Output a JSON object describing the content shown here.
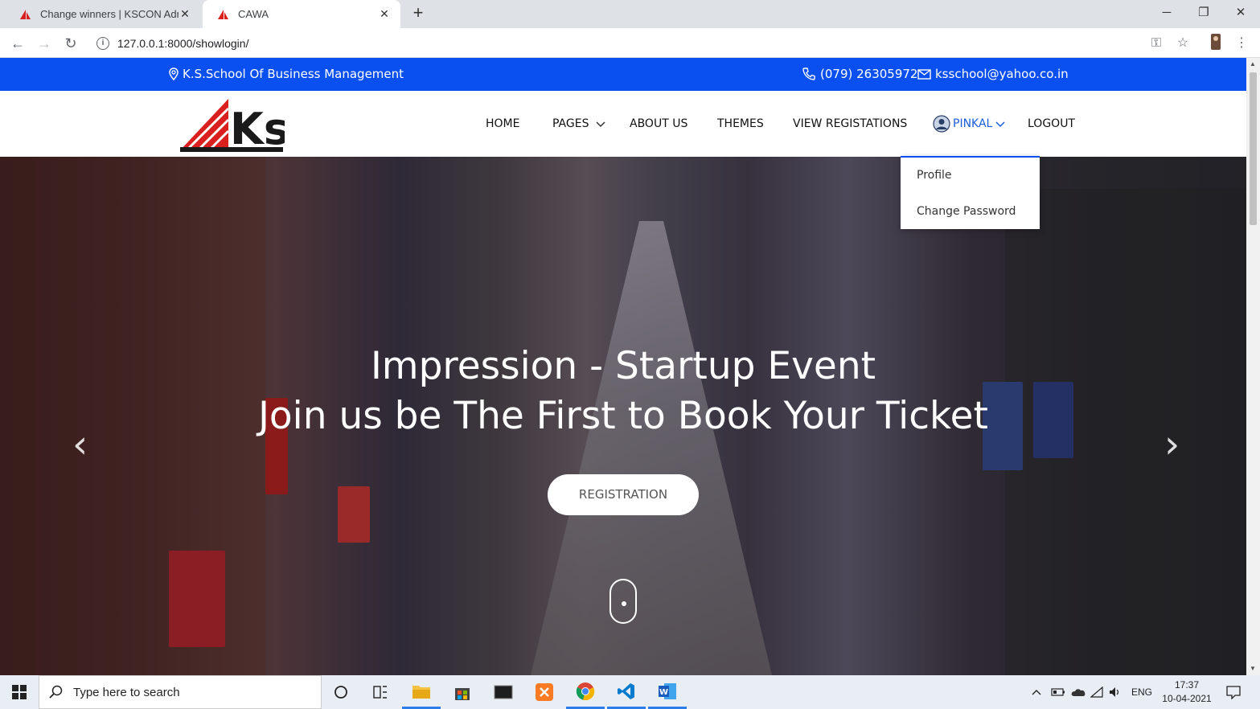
{
  "browser": {
    "tabs": [
      {
        "title": "Change winners | KSCON Admin",
        "active": false
      },
      {
        "title": "CAWA",
        "active": true
      }
    ],
    "url": "127.0.0.1:8000/showlogin/"
  },
  "topbar": {
    "location": "K.S.School Of Business Management",
    "phone": "(079) 26305972",
    "email": "ksschool@yahoo.co.in"
  },
  "logo": {
    "text": "Ks"
  },
  "nav": {
    "home": "HOME",
    "pages": "PAGES",
    "about": "ABOUT US",
    "themes": "THEMES",
    "view_registrations": "VIEW REGISTATIONS",
    "user": "PINKAL",
    "logout": "LOGOUT"
  },
  "user_menu": {
    "profile": "Profile",
    "change_password": "Change Password"
  },
  "hero": {
    "title": "Impression - Startup Event",
    "subtitle": "Join us be The First to Book Your Ticket",
    "button": "REGISTRATION",
    "prev": "‹",
    "next": "›"
  },
  "taskbar": {
    "search_placeholder": "Type here to search",
    "language": "ENG",
    "time": "17:37",
    "date": "10-04-2021"
  },
  "colors": {
    "topbar": "#0a4ff0",
    "logo_red": "#d9201f",
    "user_link": "#1a5dd8"
  }
}
